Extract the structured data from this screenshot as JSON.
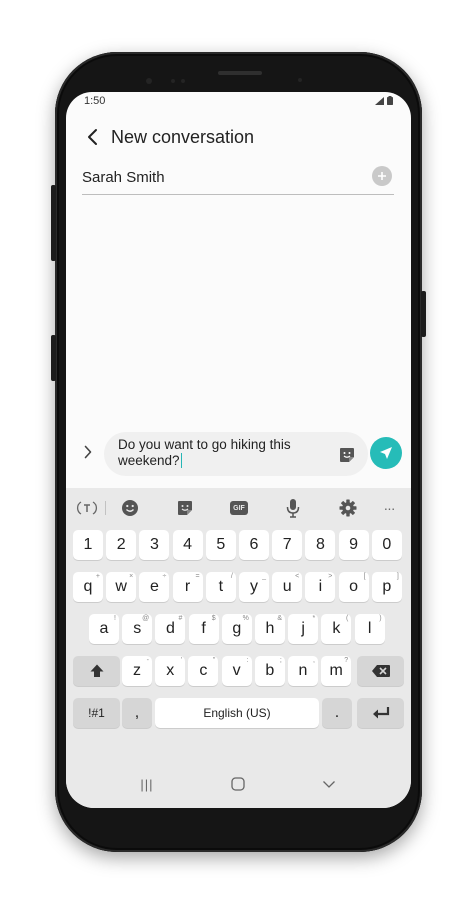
{
  "status_bar": {
    "time": "1:50"
  },
  "header": {
    "title": "New conversation"
  },
  "recipient": {
    "name": "Sarah Smith"
  },
  "compose": {
    "line1": "Do you want to go hiking this",
    "line2": "weekend?"
  },
  "keyboard": {
    "toolbar": [
      "translate-icon",
      "emoji-icon",
      "sticker-icon",
      "gif-icon",
      "mic-icon",
      "settings-icon",
      "more-icon"
    ],
    "gif_label": "GIF",
    "more_label": "···",
    "number_row": [
      "1",
      "2",
      "3",
      "4",
      "5",
      "6",
      "7",
      "8",
      "9",
      "0"
    ],
    "row1": [
      {
        "k": "q",
        "h": "+"
      },
      {
        "k": "w",
        "h": "×"
      },
      {
        "k": "e",
        "h": "÷"
      },
      {
        "k": "r",
        "h": "="
      },
      {
        "k": "t",
        "h": "/"
      },
      {
        "k": "y",
        "h": "_"
      },
      {
        "k": "u",
        "h": "<"
      },
      {
        "k": "i",
        "h": ">"
      },
      {
        "k": "o",
        "h": "["
      },
      {
        "k": "p",
        "h": "]"
      }
    ],
    "row2": [
      {
        "k": "a",
        "h": "!"
      },
      {
        "k": "s",
        "h": "@"
      },
      {
        "k": "d",
        "h": "#"
      },
      {
        "k": "f",
        "h": "$"
      },
      {
        "k": "g",
        "h": "%"
      },
      {
        "k": "h",
        "h": "&"
      },
      {
        "k": "j",
        "h": "*"
      },
      {
        "k": "k",
        "h": "("
      },
      {
        "k": "l",
        "h": ")"
      }
    ],
    "row3": [
      {
        "k": "z",
        "h": "-"
      },
      {
        "k": "x",
        "h": "'"
      },
      {
        "k": "c",
        "h": "\""
      },
      {
        "k": "v",
        "h": ":"
      },
      {
        "k": "b",
        "h": ";"
      },
      {
        "k": "n",
        "h": ","
      },
      {
        "k": "m",
        "h": "?"
      }
    ],
    "symbols_label": "!#1",
    "comma_label": ",",
    "space_label": "English (US)",
    "period_label": "."
  },
  "nav": {
    "recents": "|||"
  },
  "colors": {
    "accent": "#26bcb8",
    "keyboard_bg": "#e9e9e9",
    "key_bg": "#ffffff",
    "dark_key_bg": "#d6d6d6"
  }
}
